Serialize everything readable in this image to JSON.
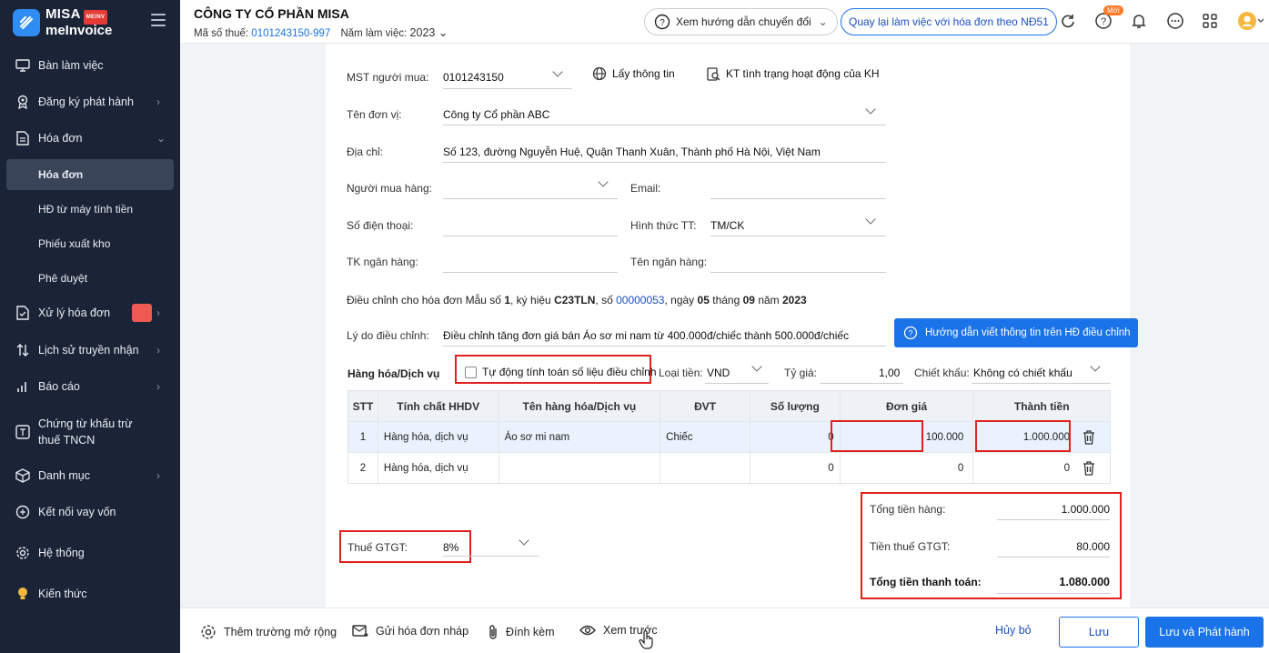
{
  "brand": {
    "line1": "MISA",
    "line2": "meInvoice",
    "badge": "MEINV"
  },
  "sidebar": {
    "items": [
      {
        "label": "Bàn làm việc"
      },
      {
        "label": "Đăng ký phát hành"
      },
      {
        "label": "Hóa đơn"
      },
      {
        "label": "Xử lý hóa đơn"
      },
      {
        "label": "Lịch sử truyền nhận"
      },
      {
        "label": "Báo cáo"
      },
      {
        "label": "Chứng từ khấu trừ thuế TNCN"
      },
      {
        "label": "Danh mục"
      },
      {
        "label": "Kết nối vay vốn"
      },
      {
        "label": "Hệ thống"
      },
      {
        "label": "Kiến thức"
      }
    ],
    "sub_items": [
      {
        "label": "Hóa đơn"
      },
      {
        "label": "HĐ từ máy tính tiền"
      },
      {
        "label": "Phiếu xuất kho"
      },
      {
        "label": "Phê duyệt"
      }
    ]
  },
  "header": {
    "company": "CÔNG TY CỔ PHẦN MISA",
    "mst_label": "Mã số thuế:",
    "mst_value": "0101243150-997",
    "year_label": "Năm làm việc:",
    "year_value": "2023",
    "guide_button": "Xem hướng dẫn chuyển đổi",
    "back_button": "Quay lại làm việc với hóa đơn theo NĐ51",
    "new_badge": "Mới"
  },
  "form": {
    "mst_buyer_label": "MST người mua:",
    "mst_buyer_value": "0101243150",
    "lookup_link": "Lấy thông tin",
    "check_link": "KT tình trạng hoạt động của KH",
    "unit_label": "Tên đơn vị:",
    "unit_value": "Công ty Cổ phần ABC",
    "address_label": "Địa chỉ:",
    "address_value": "Số 123, đường Nguyễn Huệ, Quận Thanh Xuân, Thành phố Hà Nội, Việt Nam",
    "buyer_label": "Người mua hàng:",
    "email_label": "Email:",
    "phone_label": "Số điện thoại:",
    "payment_label": "Hình thức TT:",
    "payment_value": "TM/CK",
    "bank_acc_label": "TK ngân hàng:",
    "bank_name_label": "Tên ngân hàng:",
    "adjust_prefix": "Điều chỉnh cho hóa đơn Mẫu số",
    "adjust_form_no": "1",
    "adjust_symbol_label": ", ký hiệu",
    "adjust_symbol": "C23TLN",
    "adjust_no_label": ", số",
    "adjust_no": "00000053",
    "adjust_date_label": ", ngày",
    "adjust_day": "05",
    "adjust_month_label": "tháng",
    "adjust_month": "09",
    "adjust_year_label": "năm",
    "adjust_year": "2023",
    "reason_label": "Lý do điều chỉnh:",
    "reason_value": "Điều chỉnh tăng đơn giá bán Áo sơ mi nam từ 400.000đ/chiếc thành 500.000đ/chiếc",
    "help_button": "Hướng dẫn viết thông tin trên HĐ điều chỉnh"
  },
  "goods": {
    "section_label": "Hàng hóa/Dịch vụ",
    "auto_calc_label": "Tự động tính toán số liệu điều chỉnh",
    "currency_label": "Loại tiền:",
    "currency_value": "VND",
    "rate_label": "Tỷ giá:",
    "rate_value": "1,00",
    "discount_label": "Chiết khấu:",
    "discount_value": "Không có chiết khấu",
    "columns": [
      "STT",
      "Tính chất HHDV",
      "Tên hàng hóa/Dịch vụ",
      "ĐVT",
      "Số lượng",
      "Đơn giá",
      "Thành tiền"
    ],
    "rows": [
      {
        "stt": "1",
        "type": "Hàng hóa, dịch vụ",
        "name": "Áo sơ mi nam",
        "unit": "Chiếc",
        "qty": "0",
        "price": "100.000",
        "amount": "1.000.000"
      },
      {
        "stt": "2",
        "type": "Hàng hóa, dịch vụ",
        "name": "",
        "unit": "",
        "qty": "0",
        "price": "0",
        "amount": "0"
      }
    ]
  },
  "tax": {
    "label": "Thuế GTGT:",
    "value": "8%"
  },
  "totals": {
    "goods_label": "Tổng tiền hàng:",
    "goods_value": "1.000.000",
    "vat_label": "Tiền thuế GTGT:",
    "vat_value": "80.000",
    "pay_label": "Tổng tiền thanh toán:",
    "pay_value": "1.080.000"
  },
  "footer": {
    "add_field": "Thêm trường mở rộng",
    "send_draft": "Gửi hóa đơn nháp",
    "attach": "Đính kèm",
    "preview": "Xem trước",
    "cancel": "Hủy bỏ",
    "save": "Lưu",
    "save_publish": "Lưu và Phát hành"
  },
  "colors": {
    "accent": "#1a73e8",
    "sidebar": "#1b2437",
    "highlight": "#e0211d"
  }
}
